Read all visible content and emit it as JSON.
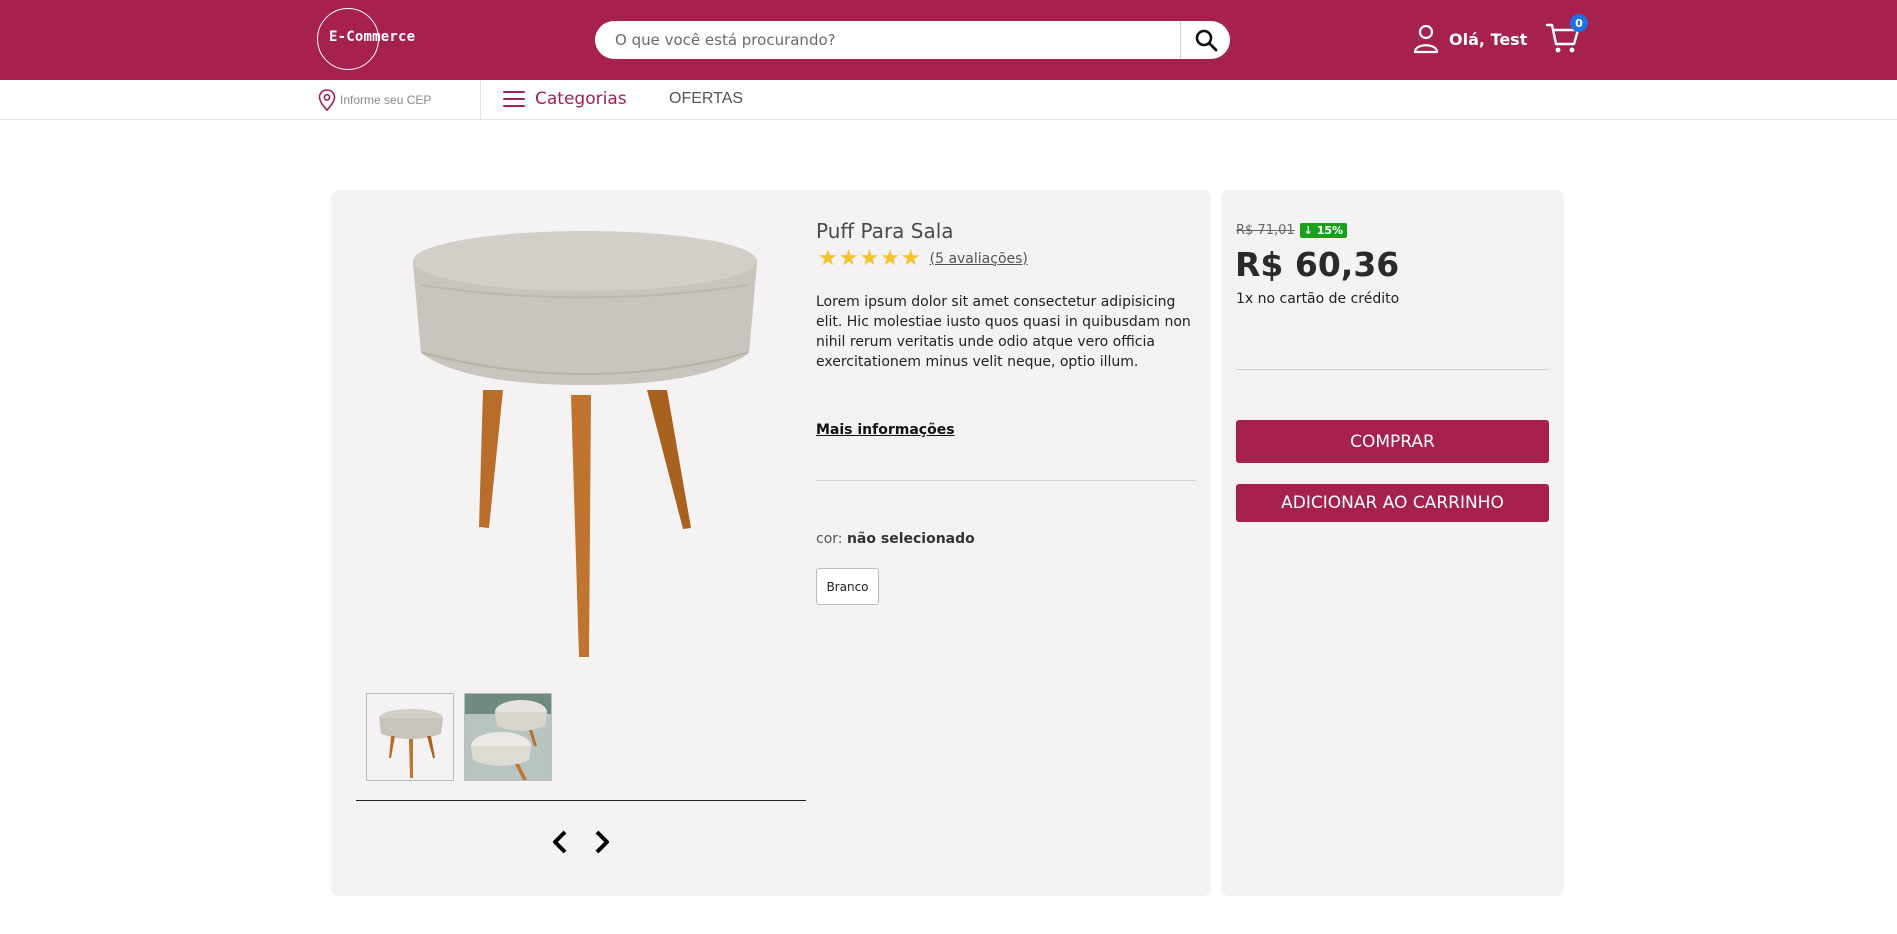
{
  "header": {
    "logo_text": "E-Commerce",
    "search_placeholder": "O que você está procurando?",
    "user_greeting": "Olá, Test",
    "cart_count": "0"
  },
  "subnav": {
    "cep_label": "Informe seu CEP",
    "categories_label": "Categorias",
    "offers_label": "OFERTAS"
  },
  "product": {
    "title": "Puff Para Sala",
    "rating_stars": "★★★★★",
    "rating_value": 5,
    "reviews_label": "(5 avaliações)",
    "description": "Lorem ipsum dolor sit amet consectetur adipisicing elit. Hic molestiae iusto quos quasi in quibusdam non nihil rerum veritatis unde odio atque vero officia exercitationem minus velit neque, optio illum.",
    "more_info_label": "Mais informações",
    "color_prefix": "cor: ",
    "color_selected": "não selecionado",
    "color_options": [
      "Branco"
    ]
  },
  "pricing": {
    "old_price": "R$ 71,01",
    "discount": "15%",
    "price": "R$ 60,36",
    "installments": "1x no cartão de crédito"
  },
  "actions": {
    "buy_label": "COMPRAR",
    "add_to_cart_label": "ADICIONAR AO CARRINHO"
  },
  "colors": {
    "brand": "#a62050",
    "card_bg": "#f4f2f2",
    "star": "#f4c22b",
    "discount_badge": "#1aa01a",
    "cart_badge": "#1f6fe5"
  },
  "icons": {
    "search": "search-icon",
    "user": "user-icon",
    "cart": "cart-icon",
    "location": "location-pin-icon",
    "menu": "hamburger-menu-icon",
    "prev": "chevron-left-icon",
    "next": "chevron-right-icon",
    "discount_arrow": "arrow-down-icon"
  }
}
